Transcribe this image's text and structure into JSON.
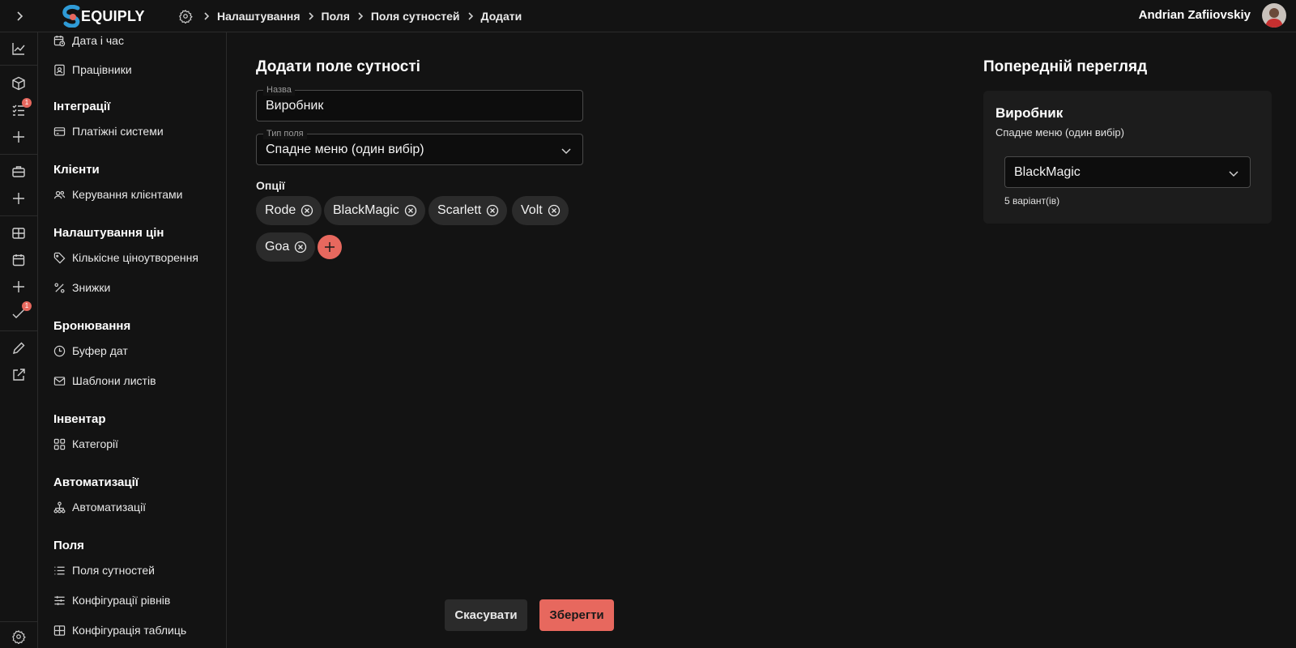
{
  "app": {
    "name": "EQUIPLY"
  },
  "breadcrumb": [
    "Налаштування",
    "Поля",
    "Поля сутностей",
    "Додати"
  ],
  "user": {
    "name": "Andrian Zafiiovskiy"
  },
  "rail": {
    "tasks_badge": "1",
    "checks_badge": "1"
  },
  "sidebar": {
    "date_time": "Дата і час",
    "employees": "Працівники",
    "integrations": {
      "title": "Інтеграції",
      "payments": "Платіжні системи"
    },
    "clients": {
      "title": "Клієнти",
      "management": "Керування клієнтами"
    },
    "pricing": {
      "title": "Налаштування цін",
      "quantity": "Кількісне ціноутворення",
      "discounts": "Знижки"
    },
    "booking": {
      "title": "Бронювання",
      "buffer": "Буфер дат",
      "templates": "Шаблони листів"
    },
    "inventory": {
      "title": "Інвентар",
      "categories": "Категорії"
    },
    "automations": {
      "title": "Автоматизації",
      "item": "Автоматизації"
    },
    "fields": {
      "title": "Поля",
      "entity_fields": "Поля сутностей",
      "level_configs": "Конфігурації рівнів",
      "table_configs": "Конфігурація таблиць"
    }
  },
  "form": {
    "title": "Додати поле сутності",
    "name_label": "Назва",
    "name_value": "Виробник",
    "type_label": "Тип поля",
    "type_value": "Спадне меню (один вибір)",
    "options_label": "Опції",
    "options": [
      "Rode",
      "BlackMagic",
      "Scarlett",
      "Volt",
      "Goa"
    ],
    "cancel": "Скасувати",
    "save": "Зберегти"
  },
  "preview": {
    "title": "Попередній перегляд",
    "field_name": "Виробник",
    "field_type": "Спадне меню (один вибір)",
    "selected": "BlackMagic",
    "count": "5 варіант(ів)"
  },
  "colors": {
    "accent": "#e7685e",
    "background": "#131313",
    "card": "#1c1c1c",
    "chip": "#2b2b2b",
    "logo_blue": "#2f9bd7"
  }
}
